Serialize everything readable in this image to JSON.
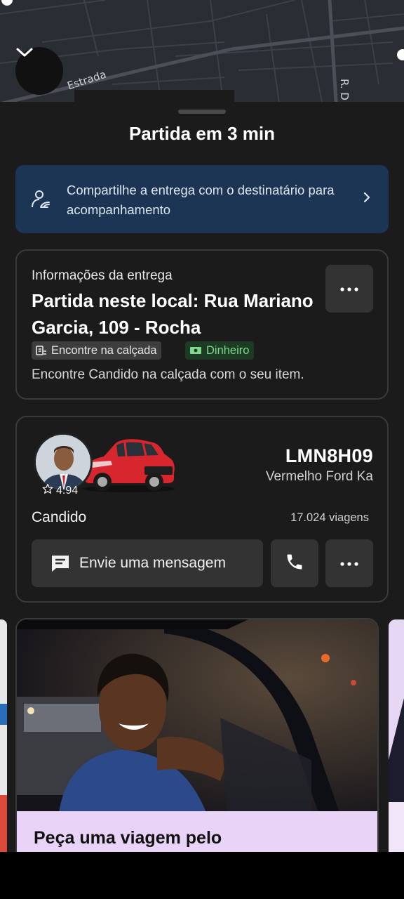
{
  "map": {
    "street_label_1": "Estrada",
    "street_label_2": "R. D",
    "collapse_icon": "chevron-down-icon"
  },
  "sheet": {
    "title": "Partida em 3 min"
  },
  "share_banner": {
    "text": "Compartilhe a entrega com o destinatário para acompanhamento",
    "icon": "share-person-icon",
    "chevron": "chevron-right-icon"
  },
  "delivery_info": {
    "label": "Informações da entrega",
    "address": "Partida neste local: Rua Mariano Garcia, 109 - Rocha",
    "tags": {
      "curb": "Encontre na calçada",
      "cash": "Dinheiro"
    },
    "note": "Encontre Candido na calçada com o seu item.",
    "more_icon": "more-horizontal-icon"
  },
  "driver": {
    "rating": "4.94",
    "plate": "LMN8H09",
    "car_model": "Vermelho Ford Ka",
    "name": "Candido",
    "trips": "17.024 viagens",
    "message_button": "Envie uma mensagem",
    "call_icon": "phone-icon",
    "more_icon": "more-horizontal-icon"
  },
  "promo": {
    "title": "Peça uma viagem pelo"
  },
  "colors": {
    "sheet_bg": "#1b1b1b",
    "banner_bg": "#1c3554",
    "button_bg": "#333333",
    "cash_tag_text": "#7fd88b",
    "promo_bottom": "#e9d3f6"
  }
}
